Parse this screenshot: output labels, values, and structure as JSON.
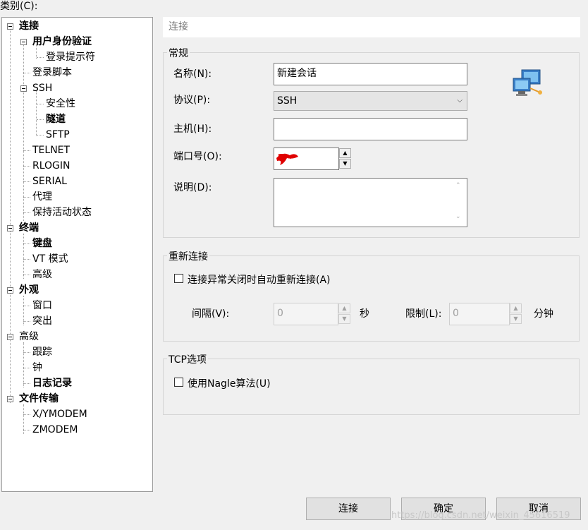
{
  "category_label": "类别(C):",
  "tree": [
    {
      "label": "连接",
      "bold": true,
      "expanded": true
    },
    {
      "label": "用户身份验证",
      "bold": true,
      "expanded": true
    },
    {
      "label": "登录提示符",
      "bold": false
    },
    {
      "label": "登录脚本",
      "bold": false
    },
    {
      "label": "SSH",
      "bold": false,
      "expanded": true
    },
    {
      "label": "安全性",
      "bold": false
    },
    {
      "label": "隧道",
      "bold": true
    },
    {
      "label": "SFTP",
      "bold": false
    },
    {
      "label": "TELNET",
      "bold": false
    },
    {
      "label": "RLOGIN",
      "bold": false
    },
    {
      "label": "SERIAL",
      "bold": false
    },
    {
      "label": "代理",
      "bold": false
    },
    {
      "label": "保持活动状态",
      "bold": false
    },
    {
      "label": "终端",
      "bold": true,
      "expanded": true
    },
    {
      "label": "键盘",
      "bold": true
    },
    {
      "label": "VT 模式",
      "bold": false
    },
    {
      "label": "高级",
      "bold": false
    },
    {
      "label": "外观",
      "bold": true,
      "expanded": true
    },
    {
      "label": "窗口",
      "bold": false
    },
    {
      "label": "突出",
      "bold": false
    },
    {
      "label": "高级",
      "bold": false,
      "expanded": true
    },
    {
      "label": "跟踪",
      "bold": false
    },
    {
      "label": "钟",
      "bold": false
    },
    {
      "label": "日志记录",
      "bold": true
    },
    {
      "label": "文件传输",
      "bold": true,
      "expanded": true
    },
    {
      "label": "X/YMODEM",
      "bold": false
    },
    {
      "label": "ZMODEM",
      "bold": false
    }
  ],
  "header": {
    "title": "连接"
  },
  "general": {
    "group_label": "常规",
    "name_label": "名称(N):",
    "name_value": "新建会话",
    "protocol_label": "协议(P):",
    "protocol_value": "SSH",
    "host_label": "主机(H):",
    "host_value": "",
    "port_label": "端口号(O):",
    "port_value": "",
    "desc_label": "说明(D):",
    "desc_value": ""
  },
  "reconnect": {
    "group_label": "重新连接",
    "checkbox_label": "连接异常关闭时自动重新连接(A)",
    "interval_label": "间隔(V):",
    "interval_value": "0",
    "interval_unit": "秒",
    "limit_label": "限制(L):",
    "limit_value": "0",
    "limit_unit": "分钟"
  },
  "tcp": {
    "group_label": "TCP选项",
    "nagle_label": "使用Nagle算法(U)"
  },
  "buttons": {
    "connect": "连接",
    "ok": "确定",
    "cancel": "取消"
  },
  "watermark": "https://blog.csdn.net/weixin_45616519"
}
